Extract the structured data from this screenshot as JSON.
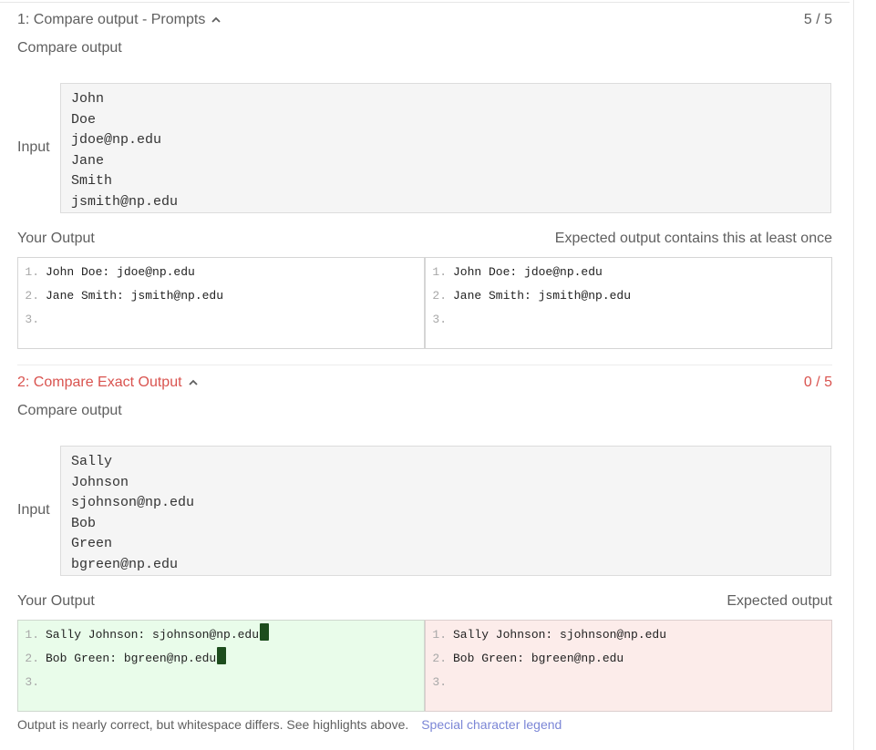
{
  "tests": [
    {
      "title": "1: Compare output - Prompts",
      "score": "5 / 5",
      "subtitle": "Compare output",
      "input_label": "Input",
      "input_lines": [
        "John",
        "Doe",
        "jdoe@np.edu",
        "Jane",
        "Smith",
        "jsmith@np.edu"
      ],
      "your_output_label": "Your Output",
      "expected_label": "Expected output contains this at least once",
      "line_numbers": [
        "1.",
        "2.",
        "3."
      ],
      "your_output_lines": [
        "John Doe: jdoe@np.edu",
        "Jane Smith: jsmith@np.edu",
        ""
      ],
      "expected_output_lines": [
        "John Doe: jdoe@np.edu",
        "Jane Smith: jsmith@np.edu",
        ""
      ]
    },
    {
      "title": "2: Compare Exact Output",
      "score": "0 / 5",
      "subtitle": "Compare output",
      "input_label": "Input",
      "input_lines": [
        "Sally",
        "Johnson",
        "sjohnson@np.edu",
        "Bob",
        "Green",
        "bgreen@np.edu"
      ],
      "your_output_label": "Your Output",
      "expected_label": "Expected output",
      "line_numbers": [
        "1.",
        "2.",
        "3."
      ],
      "your_output_lines": [
        "Sally Johnson: sjohnson@np.edu",
        "Bob Green: bgreen@np.edu",
        ""
      ],
      "expected_output_lines": [
        "Sally Johnson: sjohnson@np.edu",
        "Bob Green: bgreen@np.edu",
        ""
      ],
      "feedback": "Output is nearly correct, but whitespace differs. See highlights above.",
      "legend_link": "Special character legend"
    }
  ],
  "colors": {
    "pass_text": "#5f5f5f",
    "fail_text": "#d9534f",
    "yours_diff_bg": "#e9fcea",
    "expected_diff_bg": "#fcecea",
    "whitespace_marker": "#1d4d1d",
    "link": "#7b86d6"
  },
  "icons": {
    "collapse": "chevron-up-icon"
  }
}
